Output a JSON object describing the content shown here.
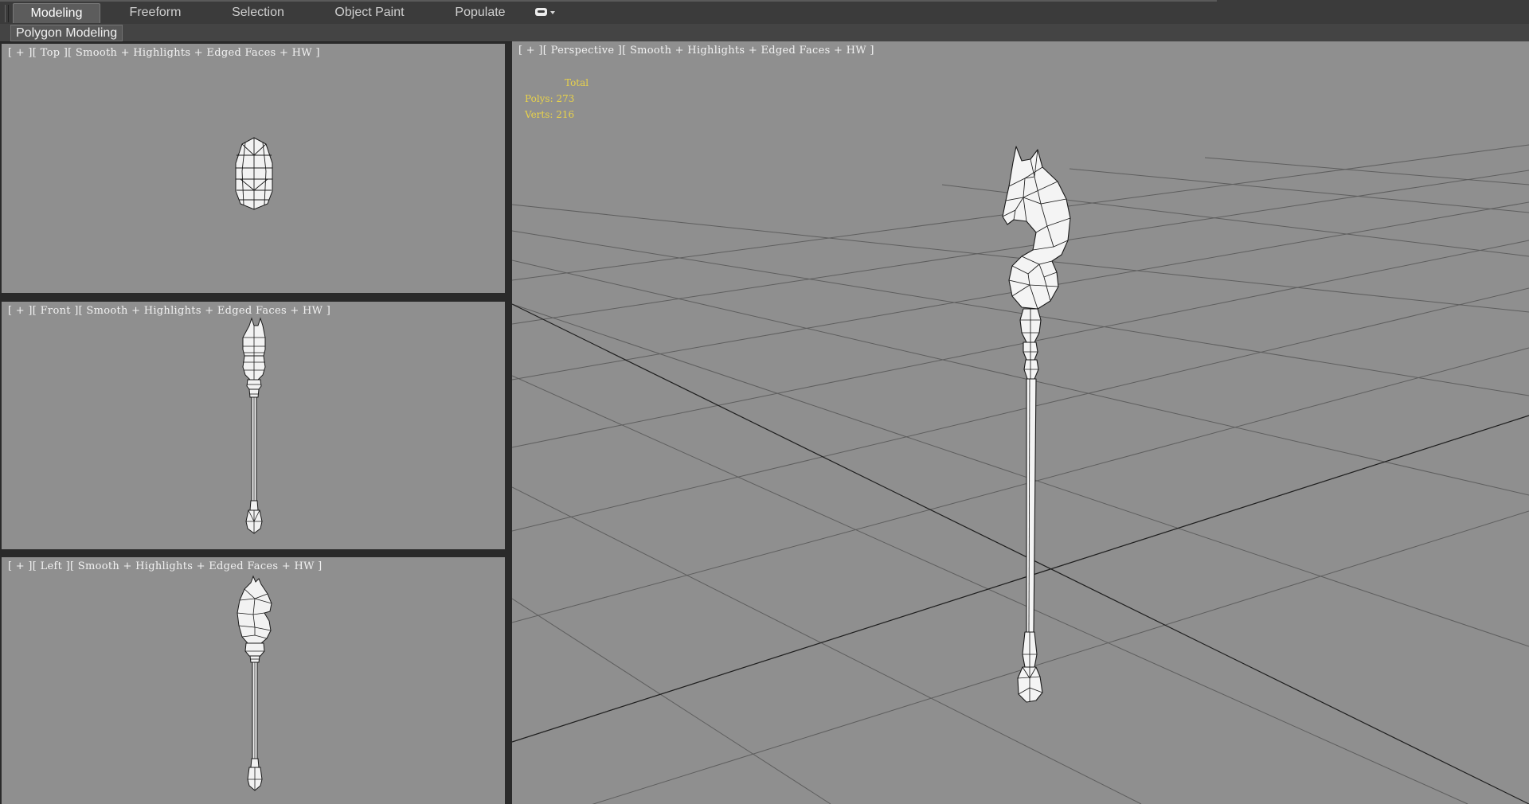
{
  "ribbon": {
    "tabs": [
      {
        "label": "Modeling",
        "active": true
      },
      {
        "label": "Freeform",
        "active": false
      },
      {
        "label": "Selection",
        "active": false
      },
      {
        "label": "Object Paint",
        "active": false
      },
      {
        "label": "Populate",
        "active": false
      }
    ],
    "panel_label": "Polygon Modeling"
  },
  "viewports": {
    "top": {
      "label": "[ + ][ Top ][ Smooth + Highlights + Edged Faces + HW ]"
    },
    "front": {
      "label": "[ + ][ Front ][ Smooth + Highlights + Edged Faces + HW ]"
    },
    "left": {
      "label": "[ + ][ Left ][ Smooth + Highlights + Edged Faces + HW ]"
    },
    "perspective": {
      "label": "[ + ][ Perspective ][ Smooth + Highlights + Edged Faces + HW ]",
      "stats": {
        "total_label": "Total",
        "polys_label": "Polys:",
        "polys": "273",
        "verts_label": "Verts:",
        "verts": "216"
      }
    }
  },
  "colors": {
    "viewport_bg": "#8f8f8f",
    "stats_text": "#e8d24a",
    "ui_dark": "#3b3b3b",
    "model_fill": "#f2f2f2",
    "model_edge": "#1a1a1a"
  },
  "icons": [
    "ribbon-options-icon",
    "dropdown-arrow-icon"
  ]
}
